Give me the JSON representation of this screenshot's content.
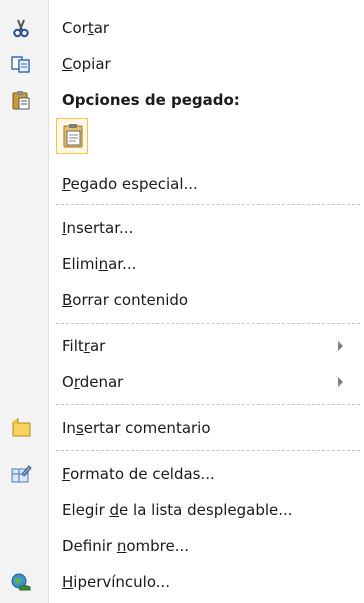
{
  "menu": {
    "cut": {
      "pre": "Cor",
      "u": "t",
      "post": "ar"
    },
    "copy": {
      "pre": "",
      "u": "C",
      "post": "opiar"
    },
    "paste_options": {
      "label": "Opciones de pegado:"
    },
    "paste_special": {
      "pre": "",
      "u": "P",
      "post": "egado especial..."
    },
    "insert": {
      "pre": "",
      "u": "I",
      "post": "nsertar..."
    },
    "delete": {
      "pre": "Elimi",
      "u": "n",
      "post": "ar..."
    },
    "clear": {
      "pre": "",
      "u": "B",
      "post": "orrar contenido"
    },
    "filter": {
      "pre": "Filt",
      "u": "r",
      "post": "ar"
    },
    "sort": {
      "pre": "O",
      "u": "r",
      "post": "denar"
    },
    "insert_comment": {
      "pre": "In",
      "u": "s",
      "post": "ertar comentario"
    },
    "format_cells": {
      "pre": "",
      "u": "F",
      "post": "ormato de celdas..."
    },
    "pick_list": {
      "pre": "Elegir ",
      "u": "d",
      "post": "e la lista desplegable..."
    },
    "define_name": {
      "pre": "Definir ",
      "u": "n",
      "post": "ombre..."
    },
    "hyperlink": {
      "pre": "",
      "u": "H",
      "post": "ipervínculo..."
    }
  },
  "icons": {
    "cut": "scissors-icon",
    "copy": "copy-icon",
    "paste_options": "clipboard-icon",
    "paste": "paste-icon",
    "insert_comment": "comment-icon",
    "format_cells": "format-cells-icon",
    "hyperlink": "hyperlink-icon",
    "submenu": "chevron-right-icon"
  },
  "colors": {
    "highlight_border": "#f0c34a",
    "separator": "#c5c5c5",
    "gutter": "#f3f3f3"
  }
}
